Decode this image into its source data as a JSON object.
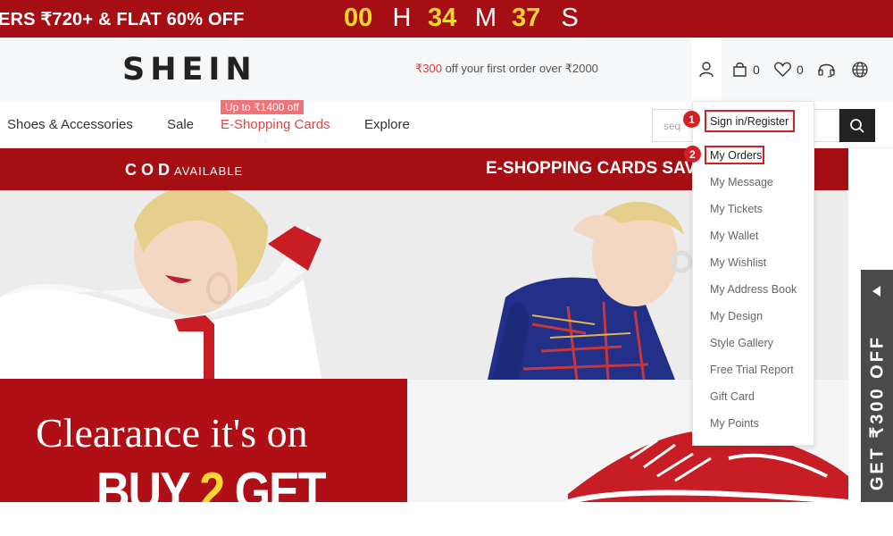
{
  "promo": {
    "text": "ERS ₹720+ & FLAT 60% OFF",
    "countdown": [
      {
        "value": "00",
        "unit": "H"
      },
      {
        "value": "34",
        "unit": "M"
      },
      {
        "value": "37",
        "unit": "S"
      }
    ]
  },
  "header": {
    "logo": "SHEIN",
    "offer_amount": "₹300",
    "offer_text": " off your first order over ₹2000",
    "cart_count": "0",
    "wishlist_count": "0",
    "icons": [
      "user-icon",
      "cart-icon",
      "heart-icon",
      "headset-icon",
      "globe-icon"
    ]
  },
  "nav": {
    "items": [
      {
        "label": "Shoes & Accessories"
      },
      {
        "label": "Sale"
      },
      {
        "label": "E-Shopping Cards",
        "badge": "Up to ₹1400 off",
        "color": "#e04646"
      },
      {
        "label": "Explore"
      }
    ],
    "search_placeholder": "seq"
  },
  "banners": {
    "left": {
      "header_bold": "COD",
      "header_light": "AVAILABLE",
      "title": "Clearance it's on",
      "subtitle_a": "BUY ",
      "subtitle_num": "2",
      "subtitle_b": " GET"
    },
    "right": {
      "header": "E-SHOPPING CARDS SAV"
    }
  },
  "account_menu": {
    "items": [
      "Sign in/Register",
      "My Orders",
      "My Message",
      "My Tickets",
      "My Wallet",
      "My Wishlist",
      "My Address Book",
      "My Design",
      "Style Gallery",
      "Free Trial Report",
      "Gift Card",
      "My Points"
    ],
    "markers": [
      "1",
      "2"
    ]
  },
  "side_tab": {
    "text": "GET ₹300 OFF"
  },
  "colors": {
    "brand_red": "#a50f14",
    "countdown_yellow": "#ffd531",
    "highlight_red": "#d51f26"
  }
}
